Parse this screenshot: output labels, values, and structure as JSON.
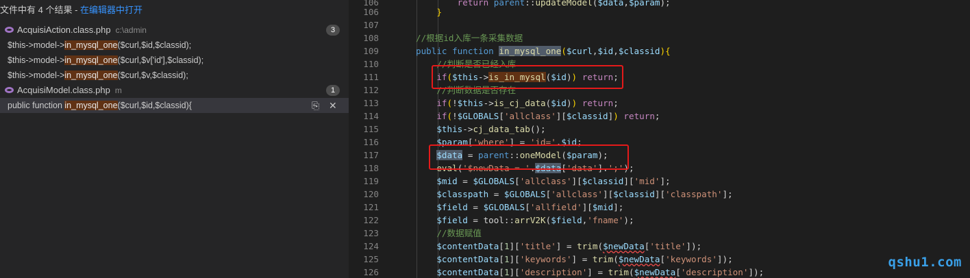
{
  "search": {
    "summary_prefix": "文件中有 4 个结果 - ",
    "open_in_editor": "在编辑器中打开",
    "files": [
      {
        "name": "AcquisiAction.class.php",
        "path": "c:\\admin",
        "count": "3",
        "matches": [
          {
            "before": "$this->model->",
            "hit": "in_mysql_one",
            "after": "($curl,$id,$classid);"
          },
          {
            "before": "$this->model->",
            "hit": "in_mysql_one",
            "after": "($curl,$v['id'],$classid);"
          },
          {
            "before": "$this->model->",
            "hit": "in_mysql_one",
            "after": "($curl,$v,$classid);"
          }
        ]
      },
      {
        "name": "AcquisiModel.class.php",
        "path": "m",
        "count": "1",
        "matches": [
          {
            "before": "public function ",
            "hit": "in_mysql_one",
            "after": "($curl,$id,$classid){"
          }
        ]
      }
    ],
    "icons": {
      "replace": "replace-icon",
      "dismiss": "close-icon"
    }
  },
  "editor": {
    "line_numbers": [
      "106",
      "107",
      "108",
      "109",
      "110",
      "111",
      "112",
      "113",
      "114",
      "115",
      "116",
      "117",
      "118",
      "119",
      "120",
      "121",
      "122",
      "123",
      "124",
      "125",
      "126"
    ]
  },
  "watermark": "qshu1.com",
  "colors": {
    "accent_link": "#3794ff",
    "highlight_box": "#e51a1a",
    "match_bg": "#613214"
  }
}
